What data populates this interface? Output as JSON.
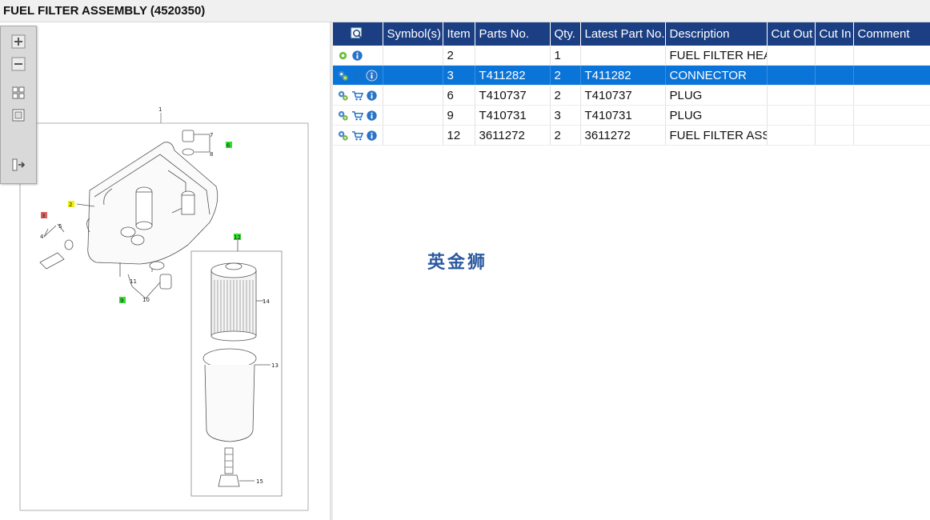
{
  "header": {
    "title": "FUEL FILTER ASSEMBLY (4520350)"
  },
  "toolbox": {
    "items": [
      {
        "icon": "zoom-in-icon"
      },
      {
        "icon": "zoom-out-icon"
      },
      {
        "icon": "fit-all-icon"
      },
      {
        "icon": "fit-window-icon"
      },
      {
        "icon": "toggle-list-icon"
      }
    ]
  },
  "diagram": {
    "callouts": [
      "1",
      "2",
      "3",
      "4",
      "5",
      "6",
      "7",
      "8",
      "9",
      "10",
      "11",
      "12",
      "13",
      "14",
      "15"
    ],
    "highlight_colors": {
      "green": "#33dd33",
      "yellow": "#f2f20a",
      "red": "#e06060"
    }
  },
  "table": {
    "columns": [
      "",
      "Symbol(s)",
      "Item",
      "Parts No.",
      "Qty.",
      "Latest Part No.",
      "Description",
      "Cut Out",
      "Cut In",
      "Comment"
    ],
    "rows": [
      {
        "icons": [
          "gear-icon",
          "info-icon"
        ],
        "symbol": "",
        "item": "2",
        "part_no": "",
        "qty": "1",
        "latest": "",
        "description": "FUEL FILTER HEAD",
        "cut_out": "",
        "cut_in": "",
        "comment": "",
        "selected": false
      },
      {
        "icons": [
          "gears-icon",
          "cart-icon",
          "info-icon"
        ],
        "symbol": "",
        "item": "3",
        "part_no": "T411282",
        "qty": "2",
        "latest": "T411282",
        "description": "CONNECTOR",
        "cut_out": "",
        "cut_in": "",
        "comment": "",
        "selected": true
      },
      {
        "icons": [
          "gears-icon",
          "cart-icon",
          "info-icon"
        ],
        "symbol": "",
        "item": "6",
        "part_no": "T410737",
        "qty": "2",
        "latest": "T410737",
        "description": "PLUG",
        "cut_out": "",
        "cut_in": "",
        "comment": "",
        "selected": false
      },
      {
        "icons": [
          "gears-icon",
          "cart-icon",
          "info-icon"
        ],
        "symbol": "",
        "item": "9",
        "part_no": "T410731",
        "qty": "3",
        "latest": "T410731",
        "description": "PLUG",
        "cut_out": "",
        "cut_in": "",
        "comment": "",
        "selected": false
      },
      {
        "icons": [
          "gears-icon",
          "cart-icon",
          "info-icon"
        ],
        "symbol": "",
        "item": "12",
        "part_no": "3611272",
        "qty": "2",
        "latest": "3611272",
        "description": "FUEL FILTER ASSEMBLY",
        "cut_out": "",
        "cut_in": "",
        "comment": "",
        "selected": false
      }
    ]
  },
  "watermark": {
    "text": "英金狮"
  },
  "colors": {
    "header_bg": "#1b3f82",
    "selected_row": "#0a74d8"
  }
}
